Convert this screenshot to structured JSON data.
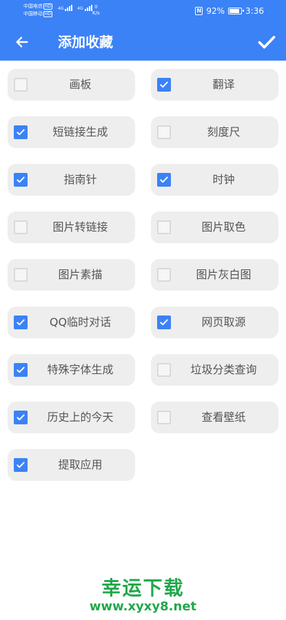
{
  "statusbar": {
    "carrier1": "中国电信",
    "carrier2": "中国移动",
    "hd": "HD",
    "net": "4G",
    "speed_value": "0",
    "speed_unit": "K/s",
    "battery": "92%",
    "time": "3:36"
  },
  "toolbar": {
    "back_icon": "arrow-left-icon",
    "title": "添加收藏",
    "confirm_icon": "check-icon"
  },
  "items": [
    {
      "label": "画板",
      "checked": false
    },
    {
      "label": "翻译",
      "checked": true
    },
    {
      "label": "短链接生成",
      "checked": true
    },
    {
      "label": "刻度尺",
      "checked": false
    },
    {
      "label": "指南针",
      "checked": true
    },
    {
      "label": "时钟",
      "checked": true
    },
    {
      "label": "图片转链接",
      "checked": false
    },
    {
      "label": "图片取色",
      "checked": false
    },
    {
      "label": "图片素描",
      "checked": false
    },
    {
      "label": "图片灰白图",
      "checked": false
    },
    {
      "label": "QQ临时对话",
      "checked": true
    },
    {
      "label": "网页取源",
      "checked": true
    },
    {
      "label": "特殊字体生成",
      "checked": true
    },
    {
      "label": "垃圾分类查询",
      "checked": false
    },
    {
      "label": "历史上的今天",
      "checked": true
    },
    {
      "label": "查看壁纸",
      "checked": false
    },
    {
      "label": "提取应用",
      "checked": true
    }
  ],
  "colors": {
    "accent": "#3b82f6",
    "card": "#eeeeee",
    "watermark": "#22a84b"
  },
  "watermark": {
    "title": "幸运下载",
    "url": "www.xyxy8.net"
  }
}
